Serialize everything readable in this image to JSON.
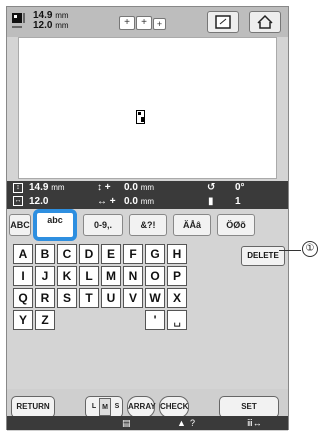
{
  "topbar": {
    "width_value": "14.9",
    "width_unit": "mm",
    "height_value": "12.0",
    "height_unit": "mm",
    "size_icon": "embroidery-size-icon",
    "layout_buttons_icon": "plus-frames-icon",
    "frame_button_icon": "frame-icon",
    "home_button_icon": "home-icon"
  },
  "info": {
    "height_value": "14.9",
    "height_unit": "mm",
    "width_value": "12.0",
    "v_offset_value": "0.0",
    "v_offset_unit": "mm",
    "h_offset_value": "0.0",
    "h_offset_unit": "mm",
    "angle_value": "0°",
    "colors_value": "1"
  },
  "tabs": [
    "ABC",
    "abc",
    "0-9,.",
    "&?!",
    "ÄÅâ",
    "ÖØõ"
  ],
  "keyboard": {
    "row1": [
      "A",
      "B",
      "C",
      "D",
      "E",
      "F",
      "G",
      "H"
    ],
    "row2": [
      "I",
      "J",
      "K",
      "L",
      "M",
      "N",
      "O",
      "P"
    ],
    "row3": [
      "Q",
      "R",
      "S",
      "T",
      "U",
      "V",
      "W",
      "X"
    ],
    "row4": [
      "Y",
      "Z",
      "",
      "",
      "",
      "",
      "'",
      "␣"
    ],
    "delete_label": "DELETE"
  },
  "bottom": {
    "return_label": "RETURN",
    "lms_labels": [
      "L",
      "M",
      "S"
    ],
    "array_label": "ARRAY",
    "check_label": "CHECK",
    "set_label": "SET",
    "status_icons": [
      "list-icon",
      "thread-question-icon",
      "stitch-arrow-icon"
    ],
    "status_question": "?"
  },
  "callout": {
    "number": "①"
  },
  "colors": {
    "active_tab_border": "#2e8fe0",
    "screen_bg": "#d4d4d4",
    "info_bar_bg": "#3a3a3a"
  }
}
